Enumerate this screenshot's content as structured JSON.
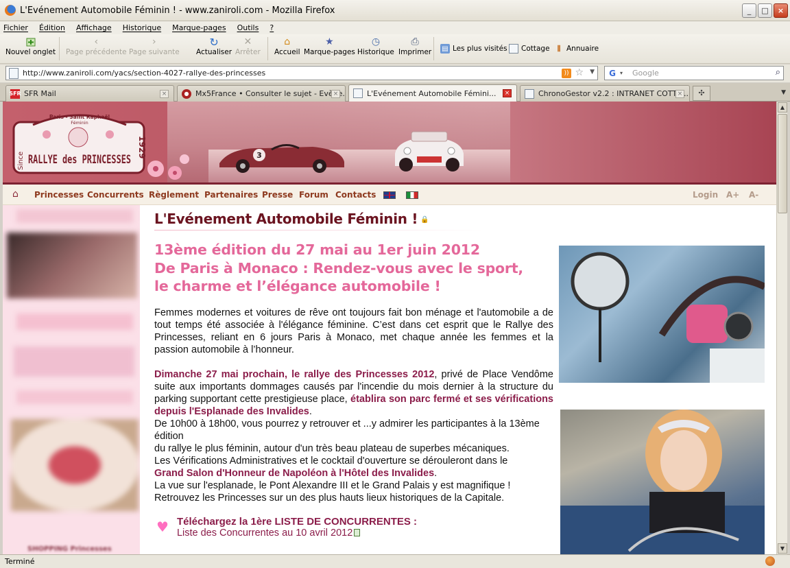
{
  "window": {
    "title": "L'Evénement Automobile Féminin ! - www.zaniroli.com - Mozilla Firefox",
    "buttons": {
      "minimize": "_",
      "maximize": "□",
      "close": "×"
    }
  },
  "menu": [
    "Fichier",
    "Édition",
    "Affichage",
    "Historique",
    "Marque-pages",
    "Outils",
    "?"
  ],
  "toolbar": {
    "new_tab": "Nouvel onglet",
    "back": "Page précédente",
    "forward": "Page suivante",
    "reload": "Actualiser",
    "stop": "Arrêter",
    "home": "Accueil",
    "bookmarks": "Marque-pages",
    "history": "Historique",
    "print": "Imprimer",
    "bm_most_visited": "Les plus visités",
    "bm_cottage": "Cottage",
    "bm_annuaire": "Annuaire"
  },
  "address": {
    "url": "http://www.zaniroli.com/yacs/section-4027-rallye-des-princesses",
    "search_placeholder": "Google"
  },
  "tabs": [
    {
      "label": "SFR Mail",
      "active": false
    },
    {
      "label": "Mx5France • Consulter le sujet - Evène...",
      "active": false
    },
    {
      "label": "L'Evénement Automobile Fémini...",
      "active": true
    },
    {
      "label": "ChronoGestor v2.2 : INTRANET COTTA...",
      "active": false
    }
  ],
  "banner": {
    "logo_top": "Paris - Saint Raphaël",
    "logo_sub": "Féminin",
    "logo_main": "RALLYE des PRINCESSES",
    "logo_since": "Since",
    "logo_year": "1929",
    "car_number": "3"
  },
  "nav": {
    "items": [
      "Princesses",
      "Concurrents",
      "Règlement",
      "Partenaires",
      "Presse",
      "Forum",
      "Contacts"
    ],
    "login": "Login",
    "font_up": "A+",
    "font_down": "A-"
  },
  "page": {
    "title": "L'Evénement Automobile Féminin !",
    "headline": [
      "13ème édition du 27 mai au 1er juin 2012",
      "De Paris à Monaco : Rendez-vous avec le sport,",
      "le charme et l’élégance automobile !"
    ],
    "intro": "Femmes modernes et voitures de rêve ont toujours fait bon ménage et l'automobile a de tout temps été associée à l'élégance féminine. C’est dans cet esprit que le Rallye des Princesses, reliant en 6 jours Paris à Monaco, met chaque année les femmes et la passion automobile à l’honneur.",
    "p2_bold1": "Dimanche 27 mai prochain, le rallye des Princesses 2012",
    "p2_text1": ", privé de Place Vendôme suite aux importants dommages causés par l'incendie du mois dernier à la structure du parking supportant cette prestigieuse place, ",
    "p2_bold2": "établira son parc fermé et ses vérifications depuis l'Esplanade des Invalides",
    "p2_text2": ".",
    "p3_line1": "De 10h00 à 18h00, vous pourrez y retrouver et ...y admirer les participantes à la 13ème édition",
    "p3_line2": "du rallye le plus féminin, autour d'un très beau plateau de superbes mécaniques.",
    "p3_line3": "Les Vérifications Administratives et le cocktail d'ouverture se dérouleront dans le",
    "p3_bold": "Grand Salon d'Honneur de Napoléon à l'Hôtel des Invalides",
    "p3_line4": "La vue sur l'esplanade, le Pont Alexandre III et le Grand Palais y est magnifique !",
    "p3_line5": "Retrouvez les Princesses sur un des plus hauts lieux historiques de la Capitale.",
    "download_title": "Téléchargez la 1ère LISTE DE CONCURRENTES :",
    "download_link": "Liste des Concurrentes au 10 avril 2012"
  },
  "sidebar": {
    "bottom_label": "SHOPPING Princesses"
  },
  "status": {
    "text": "Terminé"
  },
  "colors": {
    "brand_dark": "#6b1420",
    "headline_pink": "#e4689a",
    "accent_purple": "#8b1d4a",
    "nav_brown": "#8e3a1f",
    "sidebar_pink": "#fbe0e8"
  }
}
